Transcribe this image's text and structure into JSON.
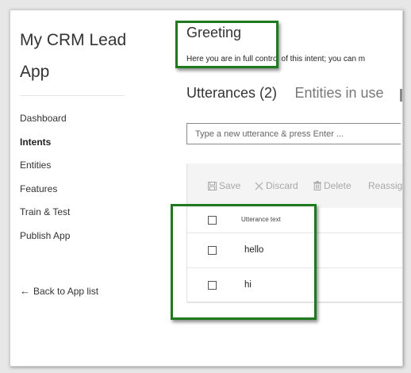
{
  "app": {
    "title": "My CRM Lead App"
  },
  "sidebar": {
    "items": [
      {
        "label": "Dashboard",
        "active": false
      },
      {
        "label": "Intents",
        "active": true
      },
      {
        "label": "Entities",
        "active": false
      },
      {
        "label": "Features",
        "active": false
      },
      {
        "label": "Train & Test",
        "active": false
      },
      {
        "label": "Publish App",
        "active": false
      }
    ],
    "back_label": "Back to App list"
  },
  "intent": {
    "title": "Greeting",
    "description": "Here you are in full control of this intent; you can m"
  },
  "tabs": [
    {
      "label": "Utterances (2)",
      "active": true
    },
    {
      "label": "Entities in use",
      "active": false
    }
  ],
  "utterance_input": {
    "placeholder": "Type a new utterance & press Enter ..."
  },
  "toolbar": {
    "save": "Save",
    "discard": "Discard",
    "delete": "Delete",
    "reassign": "Reassig"
  },
  "table": {
    "header": "Utterance text",
    "rows": [
      {
        "text": "hello",
        "checked": false
      },
      {
        "text": "hi",
        "checked": false
      }
    ]
  },
  "colors": {
    "annotation_border": "#1f7a1f",
    "toolbar_bg": "#f4f4f4",
    "disabled_text": "#a8a8a8"
  }
}
